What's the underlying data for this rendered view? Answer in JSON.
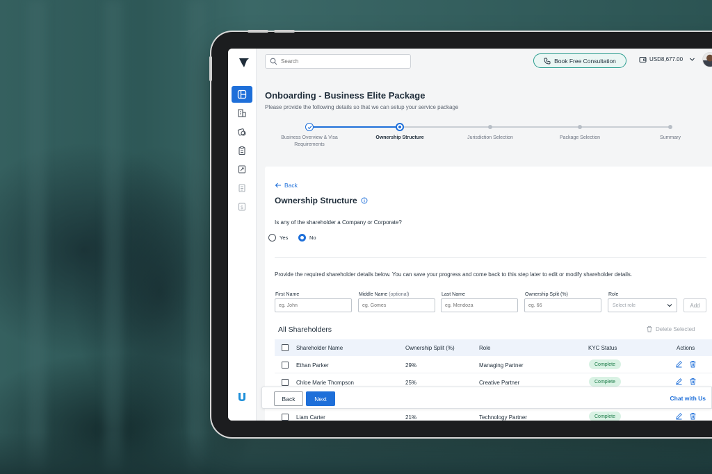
{
  "search": {
    "placeholder": "Search"
  },
  "header": {
    "consult_label": "Book Free Consultation",
    "balance": "USD8,677.00"
  },
  "page": {
    "title": "Onboarding - Business Elite Package",
    "subtitle": "Please provide the following details so that we can setup your service package"
  },
  "steps": [
    {
      "label": "Business Overview & Visa Requirements",
      "state": "done"
    },
    {
      "label": "Ownership Structure",
      "state": "current"
    },
    {
      "label": "Jurisdiction Selection",
      "state": "todo"
    },
    {
      "label": "Package Selection",
      "state": "todo"
    },
    {
      "label": "Summary",
      "state": "todo"
    }
  ],
  "form": {
    "back_label": "Back",
    "section_title": "Ownership Structure",
    "question": "Is any of the shareholder a Company or Corporate?",
    "options": {
      "yes": "Yes",
      "no": "No"
    },
    "selected": "No",
    "hint": "Provide the required shareholder details below. You can save your progress and come back to this step later to edit or modify shareholder details.",
    "fields": {
      "first_name": {
        "label": "First Name",
        "placeholder": "eg. John"
      },
      "middle_name": {
        "label": "Middle Name",
        "optional": "(optional)",
        "placeholder": "eg. Gomes"
      },
      "last_name": {
        "label": "Last Name",
        "placeholder": "eg. Mendoza"
      },
      "split": {
        "label": "Ownership Split (%)",
        "placeholder": "eg. 66"
      },
      "role": {
        "label": "Role",
        "placeholder": "Select role"
      }
    },
    "add_label": "Add"
  },
  "table": {
    "title": "All Shareholders",
    "delete_selected": "Delete Selected",
    "columns": [
      "Shareholder Name",
      "Ownership Split (%)",
      "Role",
      "KYC Status",
      "Actions"
    ],
    "rows": [
      {
        "name": "Ethan Parker",
        "split": "29%",
        "role": "Managing Partner",
        "kyc": "Complete"
      },
      {
        "name": "Chloe Marie Thompson",
        "split": "25%",
        "role": "Creative Partner",
        "kyc": "Complete"
      },
      {
        "name": "Liam Carter",
        "split": "21%",
        "role": "Technology Partner",
        "kyc": "Complete"
      }
    ]
  },
  "actionbar": {
    "back_label": "Back",
    "next_label": "Next",
    "chat_label": "Chat with Us"
  },
  "colors": {
    "accent": "#1e6fd9",
    "consult_border": "#2a9d8f",
    "badge_bg": "#d9f2e4",
    "badge_text": "#1a7a47"
  }
}
